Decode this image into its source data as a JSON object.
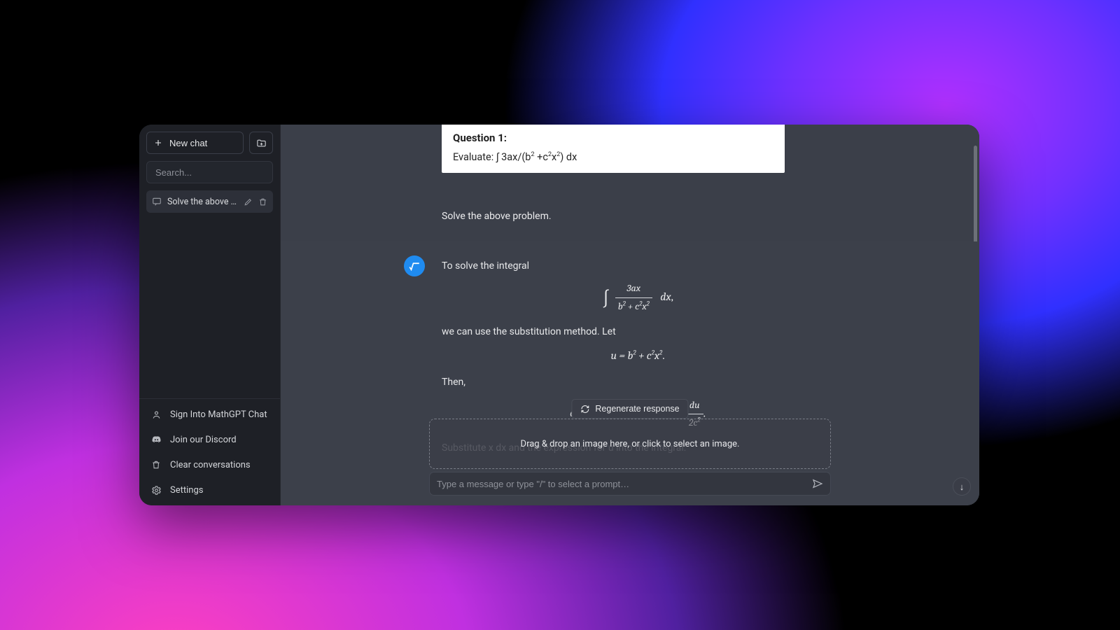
{
  "sidebar": {
    "new_chat_label": "New chat",
    "search_placeholder": "Search...",
    "conversations": [
      {
        "title": "Solve the above probl…"
      }
    ],
    "footer": {
      "signin": "Sign Into MathGPT Chat",
      "discord": "Join our Discord",
      "clear": "Clear conversations",
      "settings": "Settings"
    }
  },
  "toolbar": {
    "collapse_left_glyph": "←|",
    "collapse_right_glyph": "←|"
  },
  "question": {
    "title": "Question 1:",
    "prefix": "Evaluate: ",
    "expr_plain": "∫ 3ax/(b² + c²x²) dx"
  },
  "user_message": "Solve the above problem.",
  "assistant": {
    "line1": "To solve the integral",
    "integral": {
      "numerator": "3ax",
      "denominator_b": "b",
      "denominator_plus": " + ",
      "denominator_c": "c",
      "denominator_x": "x",
      "dx": "dx",
      "comma": ","
    },
    "line2": "we can use the substitution method. Let",
    "sub_u": "u = b² + c²x².",
    "line3": "Then,",
    "du": {
      "lhs": "du = ",
      "frac_num": "du",
      "frac_den": "2c²",
      "period": "."
    },
    "line4": "Substitute x dx and the expression for u into the integral:"
  },
  "controls": {
    "regenerate": "Regenerate response",
    "dropzone": "Drag & drop an image here, or click to select an image.",
    "input_placeholder": "Type a message or type \"/\" to select a prompt…",
    "scroll_down_glyph": "↓"
  }
}
